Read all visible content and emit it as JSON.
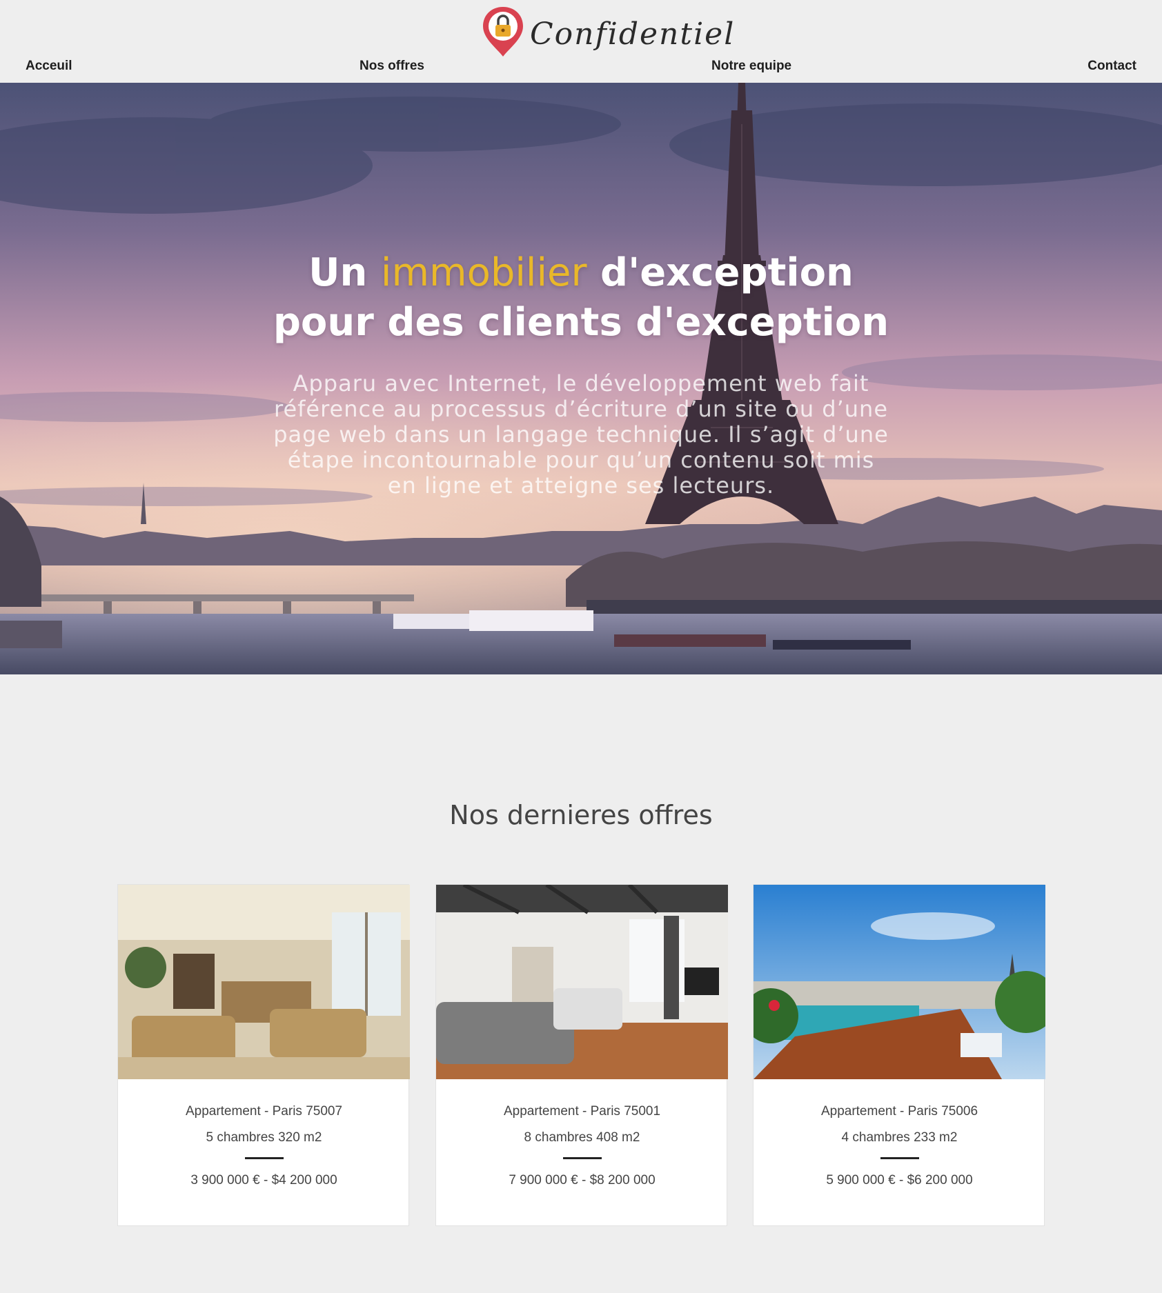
{
  "brand": {
    "name": "Confidentiel",
    "pin_color": "#d94250",
    "lock_color": "#e9a82b"
  },
  "nav": {
    "items": [
      {
        "label": "Acceuil"
      },
      {
        "label": "Nos offres"
      },
      {
        "label": "Notre equipe"
      },
      {
        "label": "Contact"
      }
    ]
  },
  "hero": {
    "title_part1": "Un ",
    "title_accent": "immobilier",
    "title_part2": " d'exception",
    "title_line2": "pour des clients d'exception",
    "text": "Apparu avec Internet, le développement web fait référence au processus d’écriture d’un site ou d’une page web dans un langage technique. Il s’agit d’une étape incontournable pour qu’un contenu soit mis en ligne et atteigne ses lecteurs.",
    "accent_color": "#e9b829"
  },
  "offers": {
    "title": "Nos dernieres offres",
    "cards": [
      {
        "type": "Appartement - Paris 75007",
        "rooms": "5 chambres 320 m2",
        "price": "3 900 000 € - $4 200 000"
      },
      {
        "type": "Appartement - Paris 75001",
        "rooms": "8 chambres 408 m2",
        "price": "7 900 000 € - $8 200 000"
      },
      {
        "type": "Appartement - Paris 75006",
        "rooms": "4 chambres 233 m2",
        "price": "5 900 000 € - $6 200 000"
      }
    ]
  }
}
